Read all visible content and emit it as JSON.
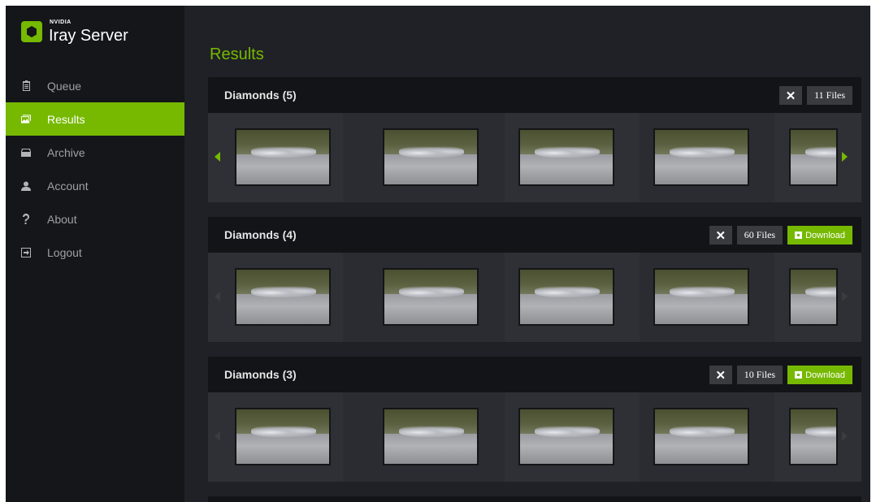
{
  "app": {
    "brand_small": "NVIDIA",
    "brand_name": "Iray Server"
  },
  "sidebar": {
    "items": [
      {
        "label": "Queue",
        "icon": "clipboard-icon",
        "active": false
      },
      {
        "label": "Results",
        "icon": "images-icon",
        "active": true
      },
      {
        "label": "Archive",
        "icon": "archive-icon",
        "active": false
      },
      {
        "label": "Account",
        "icon": "user-icon",
        "active": false
      },
      {
        "label": "About",
        "icon": "question-icon",
        "active": false
      },
      {
        "label": "Logout",
        "icon": "logout-icon",
        "active": false
      }
    ]
  },
  "page": {
    "title": "Results"
  },
  "panels": [
    {
      "title": "Diamonds (5)",
      "close": "✕",
      "files": "11 Files",
      "download": null,
      "thumbnails": 5
    },
    {
      "title": "Diamonds (4)",
      "close": "✕",
      "files": "60 Files",
      "download": "Download",
      "thumbnails": 5
    },
    {
      "title": "Diamonds (3)",
      "close": "✕",
      "files": "10 Files",
      "download": "Download",
      "thumbnails": 5
    }
  ],
  "colors": {
    "accent": "#76b900",
    "sidebar_bg": "#15161a",
    "main_bg": "#202126"
  }
}
